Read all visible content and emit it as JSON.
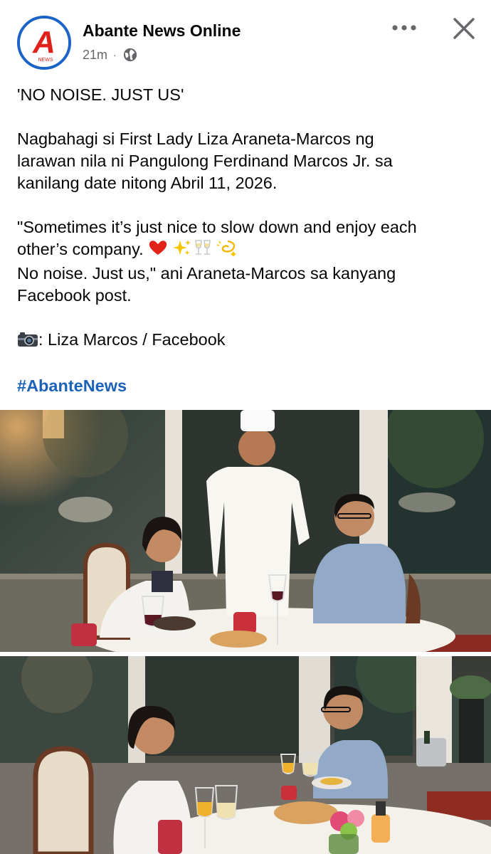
{
  "post": {
    "page_name": "Abante News Online",
    "timestamp": "21m",
    "separator": "·",
    "privacy_icon": "globe-icon",
    "avatar_logo_text": "A",
    "avatar_logo_subtext": "NEWS",
    "more_icon": "more-horizontal-icon",
    "close_icon": "close-icon",
    "headline": "'NO NOISE.  JUST US'",
    "body_lines": [
      "Nagbahagi si First Lady Liza Araneta-Marcos ng",
      "larawan nila ni Pangulong Ferdinand Marcos Jr. sa",
      "kanilang date nitong Abril 11, 2026."
    ],
    "quote_line_1": "\"Sometimes it’s just nice to slow down and enjoy each",
    "quote_line_2_prefix": "other’s company.",
    "quote_line_2_emojis": "❤️✨🥂💫",
    "quote_line_3": "No noise.  Just us,\" ani Araneta-Marcos sa kanyang",
    "quote_line_4": "Facebook post.",
    "credit_icon": "camera-icon",
    "credit_text": ": Liza Marcos / Facebook",
    "hashtag": "#AbanteNews"
  },
  "colors": {
    "accent": "#1c62b9",
    "avatar_ring": "#1a63c9",
    "logo_red": "#e0201b",
    "meta_gray": "#65676b"
  }
}
